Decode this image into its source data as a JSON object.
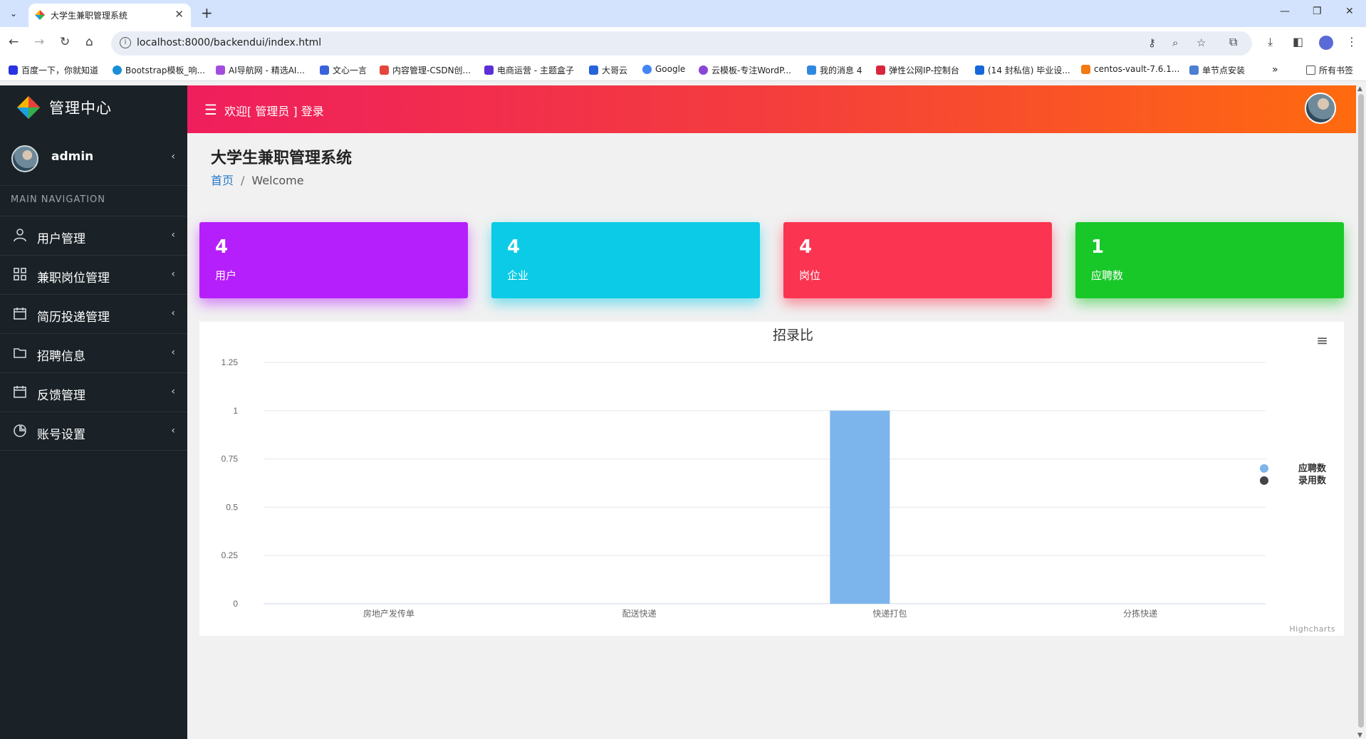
{
  "browser": {
    "tab_title": "大学生兼职管理系统",
    "url": "localhost:8000/backendui/index.html",
    "bookmarks": [
      {
        "label": "百度一下，你就知道",
        "color": "#2932e1"
      },
      {
        "label": "Bootstrap模板_响...",
        "color": "#1a8fd8"
      },
      {
        "label": "AI导航网 - 精选AI...",
        "color": "#a34de0"
      },
      {
        "label": "文心一言",
        "color": "#3a63d9"
      },
      {
        "label": "内容管理-CSDN创...",
        "color": "#e4463b"
      },
      {
        "label": "电商运营 - 主题盒子",
        "color": "#5a2fd6"
      },
      {
        "label": "大哥云",
        "color": "#2563d8"
      },
      {
        "label": "Google",
        "color": "#4285f4"
      },
      {
        "label": "云模板-专注WordP...",
        "color": "#8a46d6"
      },
      {
        "label": "我的消息 4",
        "color": "#2f88e0"
      },
      {
        "label": "弹性公网IP-控制台",
        "color": "#d8253d"
      },
      {
        "label": "(14 封私信) 毕业设...",
        "color": "#1667d9"
      },
      {
        "label": "centos-vault-7.6.1...",
        "color": "#f27a12"
      },
      {
        "label": "单节点安装",
        "color": "#4a7fd1"
      }
    ],
    "all_bookmarks": "所有书签"
  },
  "sidebar": {
    "brand": "管理中心",
    "username": "admin",
    "nav_header": "MAIN NAVIGATION",
    "items": [
      {
        "label": "用户管理",
        "icon": "user-icon"
      },
      {
        "label": "兼职岗位管理",
        "icon": "grid-icon"
      },
      {
        "label": "简历投递管理",
        "icon": "calendar-icon"
      },
      {
        "label": "招聘信息",
        "icon": "folder-icon"
      },
      {
        "label": "反馈管理",
        "icon": "calendar-icon"
      },
      {
        "label": "账号设置",
        "icon": "pie-icon"
      }
    ]
  },
  "topbar": {
    "welcome": "欢迎[ 管理员 ] 登录"
  },
  "page": {
    "title": "大学生兼职管理系统",
    "breadcrumb_home": "首页",
    "breadcrumb_sep": "/",
    "breadcrumb_current": "Welcome"
  },
  "stats": [
    {
      "value": "4",
      "label": "用户",
      "color": "#b51ffb"
    },
    {
      "value": "4",
      "label": "企业",
      "color": "#0bcbe6"
    },
    {
      "value": "4",
      "label": "岗位",
      "color": "#fb3451"
    },
    {
      "value": "1",
      "label": "应聘数",
      "color": "#18c829"
    }
  ],
  "chart_data": {
    "type": "bar",
    "title": "招录比",
    "categories": [
      "房地产发传单",
      "配送快递",
      "快递打包",
      "分拣快递"
    ],
    "series": [
      {
        "name": "应聘数",
        "color": "#7cb5ec",
        "values": [
          0,
          0,
          1,
          0
        ]
      },
      {
        "name": "录用数",
        "color": "#434348",
        "values": [
          0,
          0,
          0,
          0
        ]
      }
    ],
    "ylabel": "",
    "ylim": [
      0,
      1.25
    ],
    "yticks": [
      "0",
      "0.25",
      "0.5",
      "0.75",
      "1",
      "1.25"
    ],
    "grid": true,
    "legend": "right",
    "credit": "Highcharts"
  }
}
